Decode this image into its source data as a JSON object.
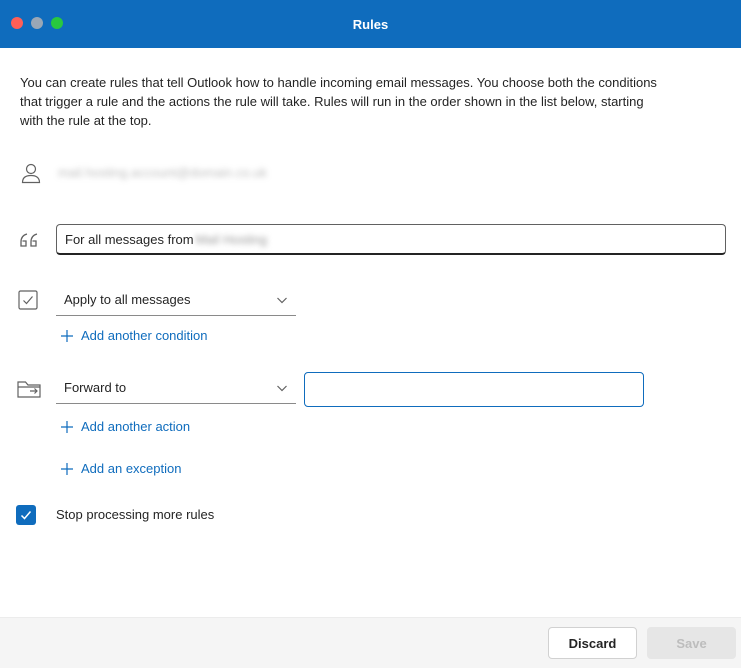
{
  "window": {
    "title": "Rules"
  },
  "intro": "You can create rules that tell Outlook how to handle incoming email messages. You choose both the conditions that trigger a rule and the actions the rule will take. Rules will run in the order shown in the list below, starting with the rule at the top.",
  "account": {
    "email": "mail.hosting.account@domain.co.uk"
  },
  "rule": {
    "name_prefix": "For all messages from",
    "name_suffix": " Mail Hosting",
    "condition": {
      "selected": "Apply to all messages",
      "add_label": "Add another condition"
    },
    "action": {
      "selected": "Forward to",
      "recipient_value": "",
      "add_label": "Add another action"
    },
    "exception": {
      "add_label": "Add an exception"
    },
    "stop_processing": {
      "label": "Stop processing more rules",
      "checked": true
    }
  },
  "footer": {
    "discard_label": "Discard",
    "save_label": "Save"
  },
  "colors": {
    "accent": "#0f6cbd",
    "title_text": "#ffffff"
  }
}
